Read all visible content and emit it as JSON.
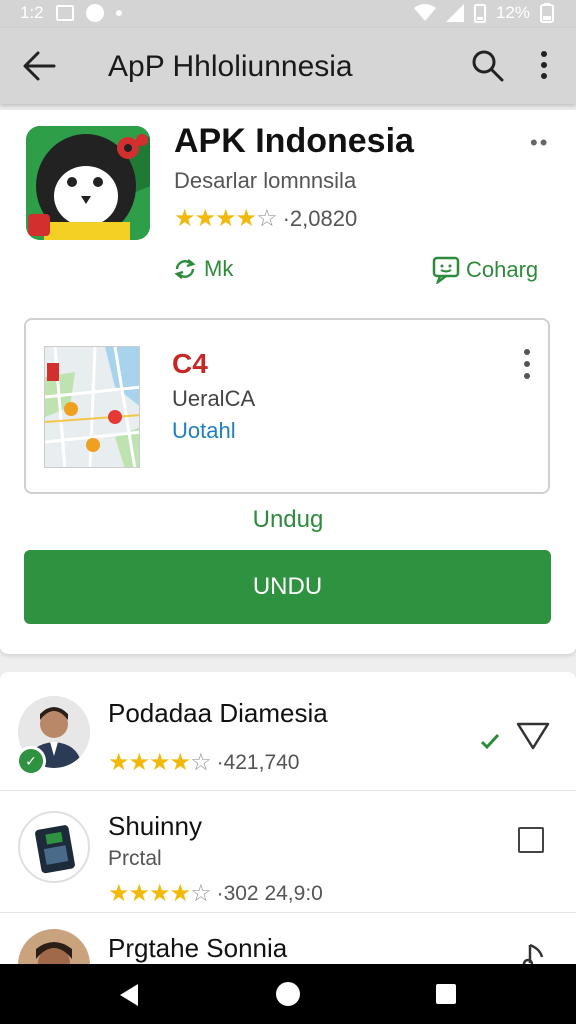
{
  "status_bar": {
    "time": "1:2",
    "battery": "12%"
  },
  "app_bar": {
    "title": "ApP Hhloliunnesia"
  },
  "featured": {
    "title": "APK Indonesia",
    "subtitle": "Desarlar lomnnsila",
    "rating": 4,
    "rating_count": "·2,0820",
    "action_left": "Mk",
    "action_right": "Coharg",
    "inner_card": {
      "number": "C4",
      "line1": "UeralCA",
      "line2": "Uotahl"
    },
    "link_label": "Undug",
    "button_label": "UNDU"
  },
  "list": [
    {
      "title": "Podadaa Diamesia",
      "rating": 4,
      "rating_count": "·421,740"
    },
    {
      "title": "Shuinny",
      "subtitle": "Prctal",
      "rating": 4,
      "rating_count": "·302 24,9:0"
    },
    {
      "title": "Prgtahe Sonnia"
    }
  ],
  "colors": {
    "accent_green": "#2e9240",
    "star": "#f1b90c",
    "red": "#c62828",
    "blue": "#1e7fc4"
  }
}
